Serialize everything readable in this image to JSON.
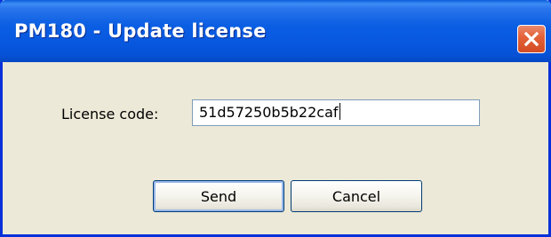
{
  "window": {
    "title": "PM180 - Update license"
  },
  "form": {
    "license_label": "License code:",
    "license_value": "51d57250b5b22caf"
  },
  "buttons": {
    "send": "Send",
    "cancel": "Cancel"
  },
  "icons": {
    "close": "close-icon"
  },
  "colors": {
    "titlebar": "#0757df",
    "frame": "#0831d9",
    "dialog_background": "#ece9d8",
    "close_button": "#e5633a"
  }
}
